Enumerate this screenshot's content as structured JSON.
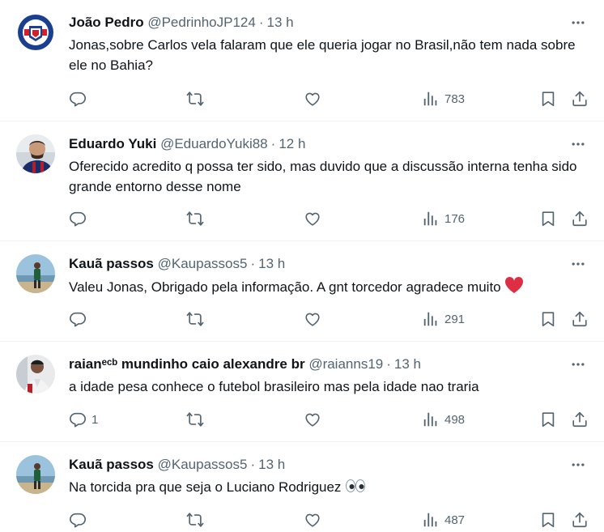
{
  "tweets": [
    {
      "name": "João Pedro",
      "handle": "@PedrinhoJP124",
      "time": "13 h",
      "text": "Jonas,sobre Carlos vela falaram que ele queria jogar no Brasil,não tem nada sobre ele no Bahia?",
      "reply_count": "",
      "views": "783"
    },
    {
      "name": "Eduardo Yuki",
      "handle": "@EduardoYuki88",
      "time": "12 h",
      "text": "Oferecido acredito q possa ter sido, mas duvido que a discussão interna tenha sido grande entorno desse nome",
      "reply_count": "",
      "views": "176"
    },
    {
      "name": "Kauã passos",
      "handle": "@Kaupassos5",
      "time": "13 h",
      "text": "Valeu Jonas, Obrigado pela informação. A gnt torcedor agradece muito",
      "emoji": "red-heart",
      "reply_count": "",
      "views": "291"
    },
    {
      "name": "raianᵉᶜᵇ mundinho caio alexandre br",
      "handle": "@raianns19",
      "time": "13 h",
      "text": "a idade pesa conhece o futebol brasileiro mas pela idade nao traria",
      "reply_count": "1",
      "views": "498"
    },
    {
      "name": "Kauã passos",
      "handle": "@Kaupassos5",
      "time": "13 h",
      "text": "Na torcida pra que seja o Luciano Rodriguez",
      "emoji": "eyes",
      "reply_count": "",
      "views": "487"
    }
  ],
  "icons": {
    "reply": "reply-icon",
    "retweet": "retweet-icon",
    "like": "like-icon",
    "views": "views-icon",
    "bookmark": "bookmark-icon",
    "share": "share-icon",
    "more": "more-icon"
  },
  "colors": {
    "text": "#0f1419",
    "secondary": "#536471",
    "divider": "#eff3f4",
    "heart": "#f91880"
  }
}
